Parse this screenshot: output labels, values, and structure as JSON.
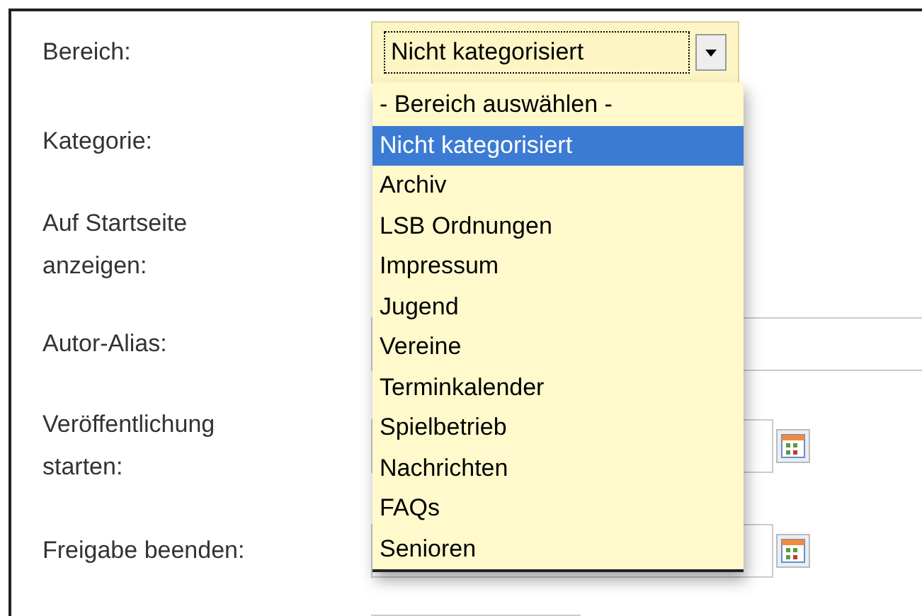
{
  "form": {
    "rows": [
      {
        "kind": "select",
        "label": "Bereich:",
        "value": "Nicht kategorisiert",
        "open": true
      },
      {
        "kind": "hidden",
        "label": "Kategorie:"
      },
      {
        "kind": "hidden",
        "label": "Auf Startseite anzeigen:"
      },
      {
        "kind": "text",
        "label": "Autor-Alias:"
      },
      {
        "kind": "date",
        "label": "Veröffentlichung starten:"
      },
      {
        "kind": "date",
        "label": "Freigabe beenden:"
      },
      {
        "kind": "stub"
      }
    ]
  },
  "dropdown": {
    "options": [
      {
        "label": "- Bereich auswählen -",
        "selected": false
      },
      {
        "label": "Nicht kategorisiert",
        "selected": true
      },
      {
        "label": "Archiv",
        "selected": false
      },
      {
        "label": "LSB Ordnungen",
        "selected": false
      },
      {
        "label": "Impressum",
        "selected": false
      },
      {
        "label": "Jugend",
        "selected": false
      },
      {
        "label": "Vereine",
        "selected": false
      },
      {
        "label": "Terminkalender",
        "selected": false
      },
      {
        "label": "Spielbetrieb",
        "selected": false
      },
      {
        "label": "Nachrichten",
        "selected": false
      },
      {
        "label": "FAQs",
        "selected": false
      },
      {
        "label": "Senioren",
        "selected": false
      }
    ]
  }
}
